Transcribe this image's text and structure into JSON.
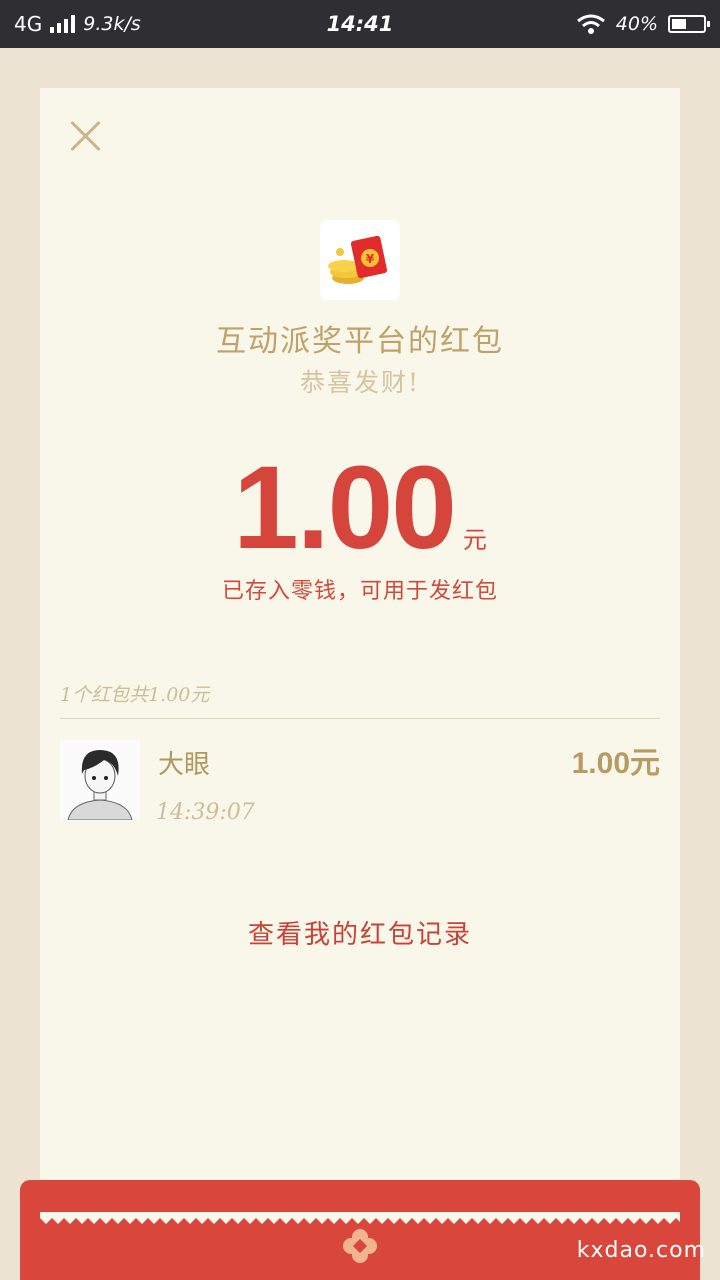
{
  "status_bar": {
    "network": "4G",
    "speed": "9.3k/s",
    "time": "14:41",
    "battery": "40%"
  },
  "card": {
    "title": "互动派奖平台的红包",
    "subtitle": "恭喜发财!",
    "amount": "1.00",
    "amount_unit": "元",
    "note": "已存入零钱，可用于发红包",
    "summary": "1个红包共1.00元",
    "records": [
      {
        "name": "大眼",
        "time": "14:39:07",
        "amount": "1.00元"
      }
    ],
    "record_link": "查看我的红包记录"
  },
  "watermark": "kxdao.com",
  "colors": {
    "accent_red": "#d6453c",
    "gold": "#bfa26a",
    "card_bg": "#f9f6ea",
    "page_bg": "#ece3d2"
  }
}
